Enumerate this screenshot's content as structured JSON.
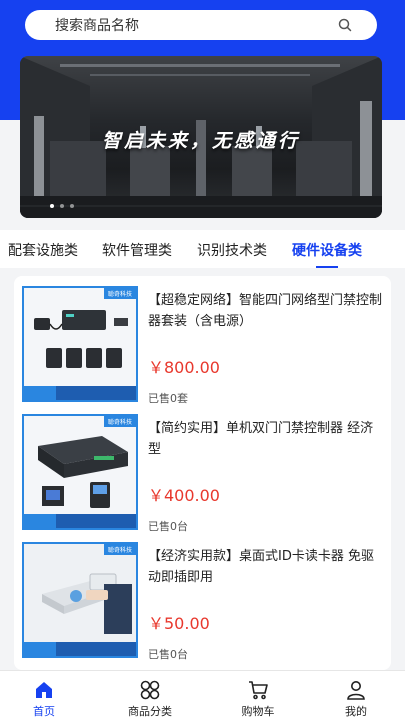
{
  "search": {
    "placeholder": "搜索商品名称",
    "icon": "search-icon"
  },
  "banner": {
    "title": "智启未来，无感通行",
    "slides": 3,
    "active_slide": 0
  },
  "tabs": [
    {
      "label": "配套设施类",
      "active": false
    },
    {
      "label": "软件管理类",
      "active": false
    },
    {
      "label": "识别技术类",
      "active": false
    },
    {
      "label": "硬件设备类",
      "active": true
    }
  ],
  "products": [
    {
      "title": "【超稳定网络】智能四门网络型门禁控制器套装（含电源）",
      "price": "￥800.00",
      "sold": "已售0套",
      "thumb_badge": "聪奇科技"
    },
    {
      "title": "【简约实用】单机双门门禁控制器 经济型",
      "price": "￥400.00",
      "sold": "已售0台",
      "thumb_badge": "聪奇科技"
    },
    {
      "title": "【经济实用款】桌面式ID卡读卡器 免驱动即插即用",
      "price": "￥50.00",
      "sold": "已售0台",
      "thumb_badge": "聪奇科技"
    }
  ],
  "bottom_nav": [
    {
      "label": "首页",
      "icon": "home-icon",
      "active": true
    },
    {
      "label": "商品分类",
      "icon": "category-icon",
      "active": false
    },
    {
      "label": "购物车",
      "icon": "cart-icon",
      "active": false
    },
    {
      "label": "我的",
      "icon": "user-icon",
      "active": false
    }
  ],
  "colors": {
    "brand": "#1641f0",
    "price": "#e8382d"
  }
}
